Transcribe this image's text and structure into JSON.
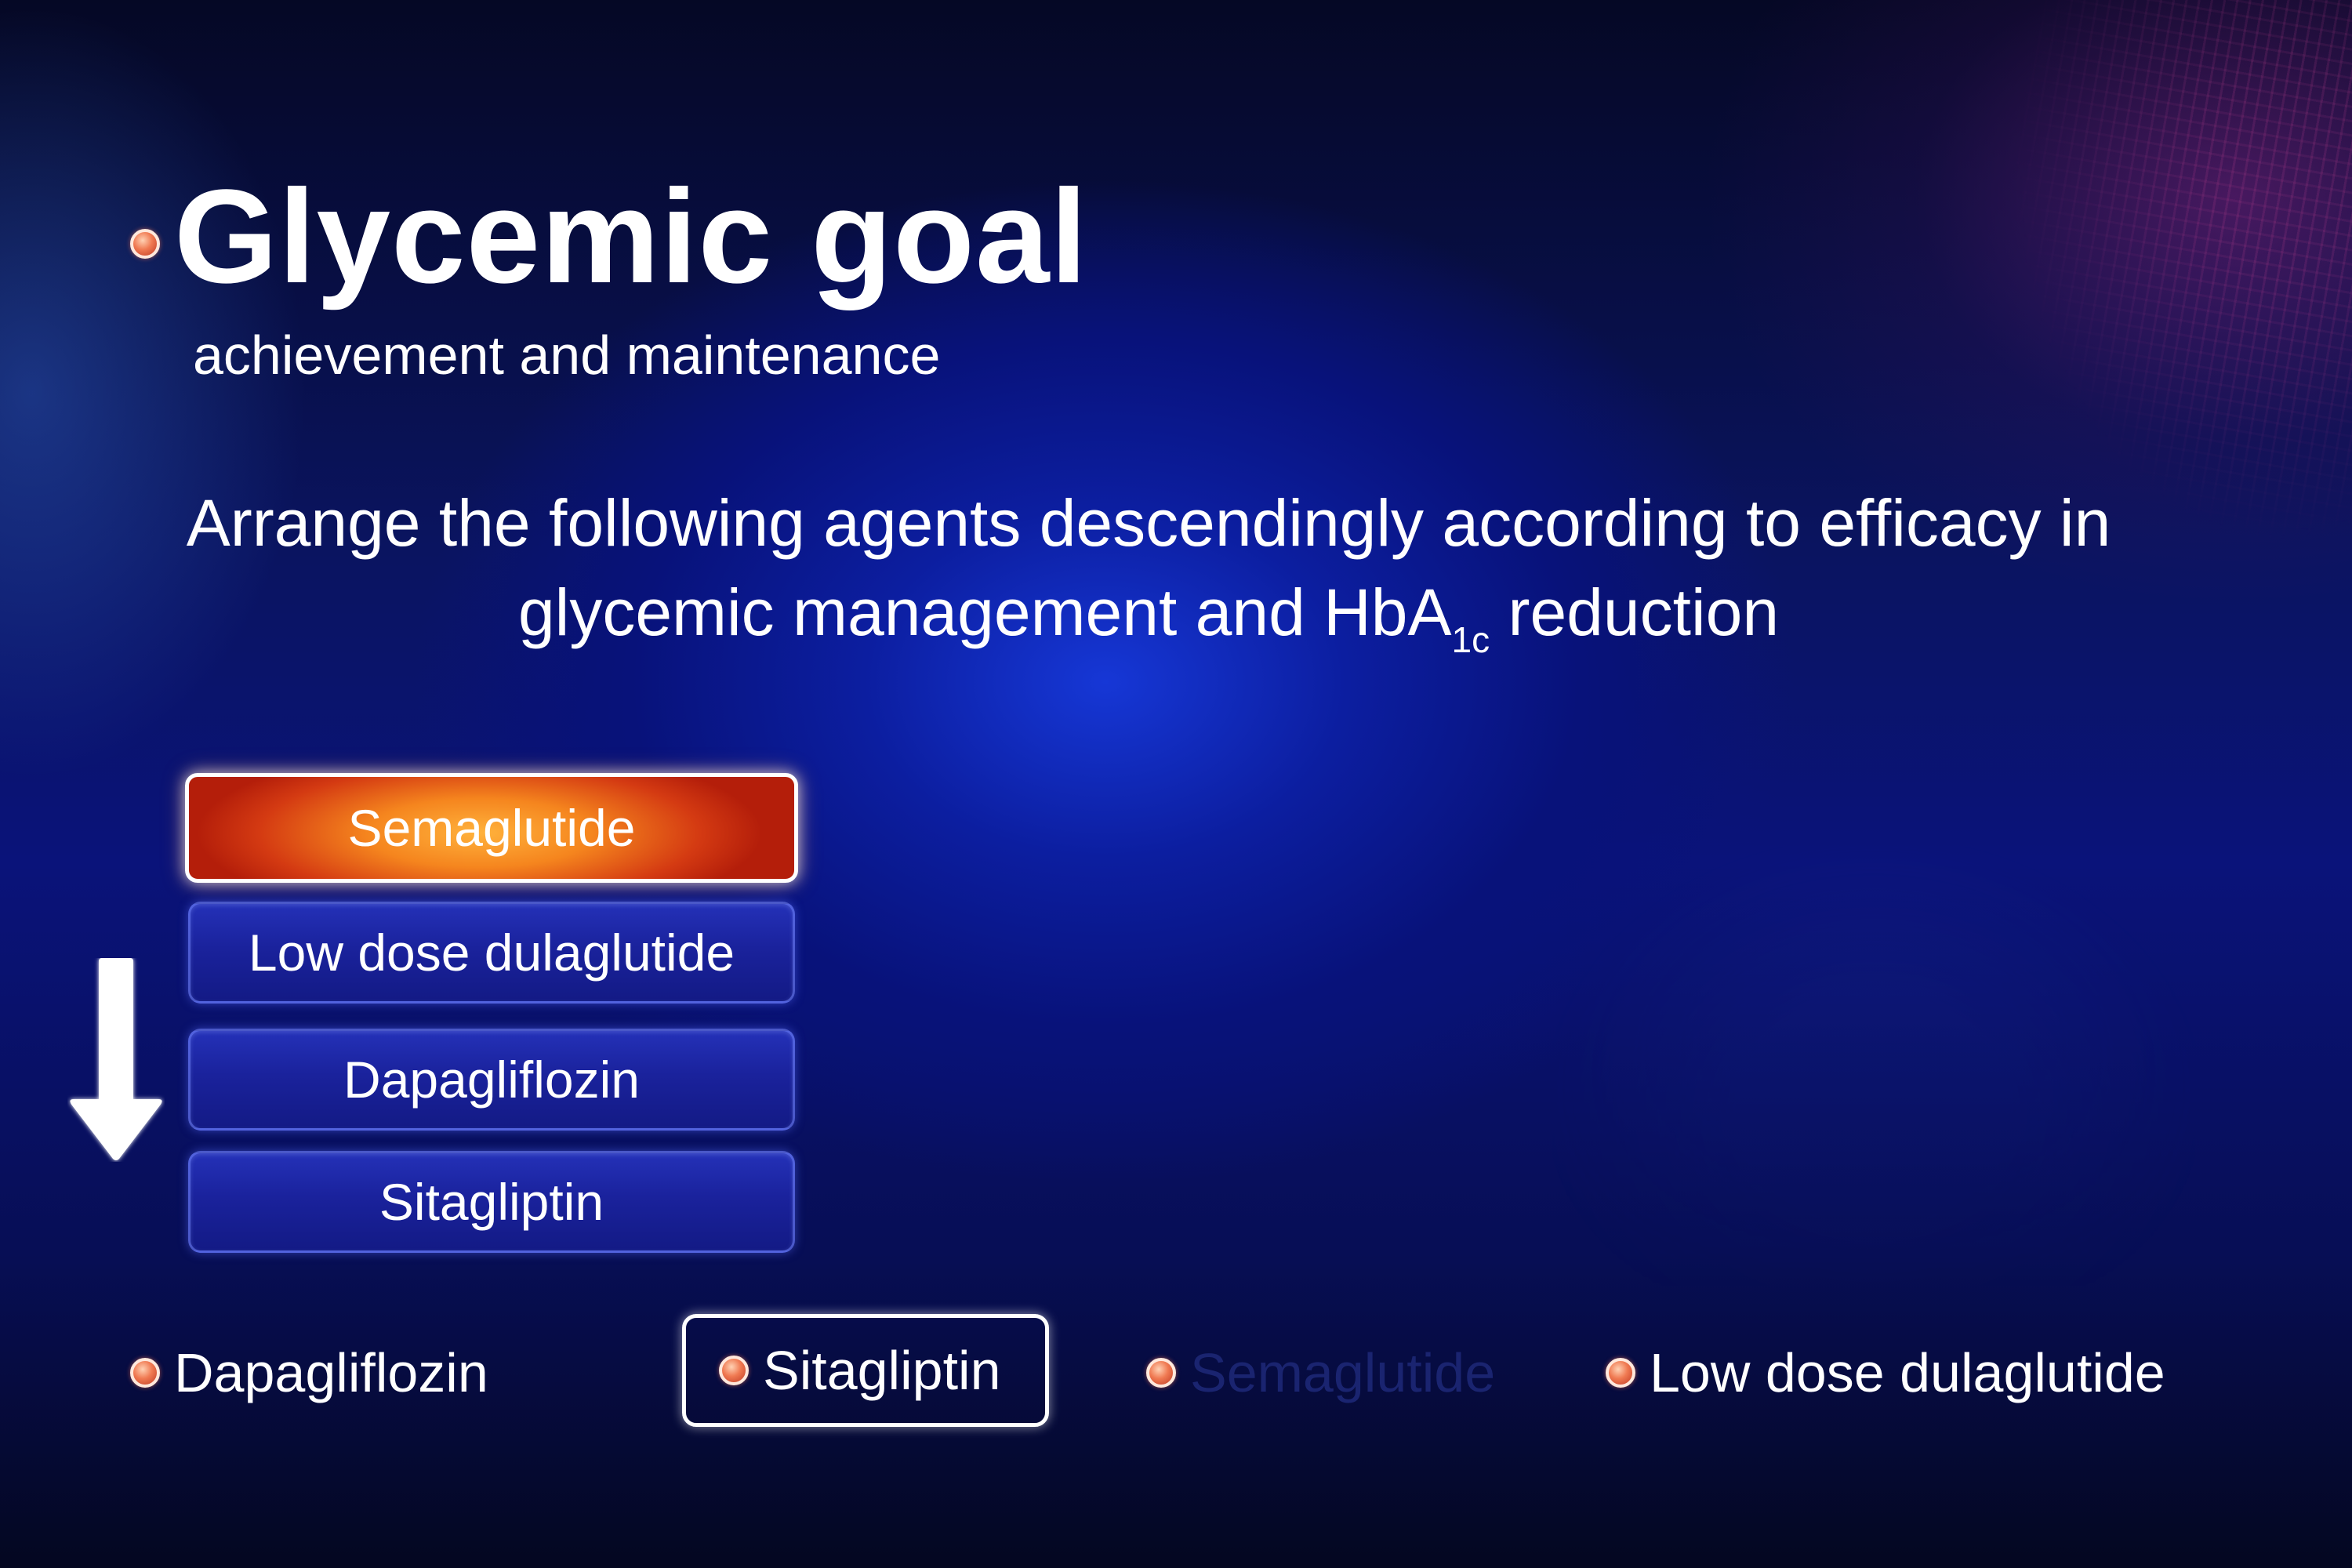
{
  "slide": {
    "title": "Glycemic goal",
    "subtitle": "achievement and maintenance",
    "question_main": "Arrange the following agents descendingly according to efficacy in glycemic management and HbA",
    "question_sub": "1c",
    "question_end": " reduction"
  },
  "ranking": {
    "items": [
      {
        "label": "Semaglutide"
      },
      {
        "label": "Low dose dulaglutide"
      },
      {
        "label": "Dapagliflozin"
      },
      {
        "label": "Sitagliptin"
      }
    ],
    "arrow_icon": "down-arrow-icon"
  },
  "options": [
    {
      "label": "Dapagliflozin",
      "state": "normal"
    },
    {
      "label": "Sitagliptin",
      "state": "selected"
    },
    {
      "label": "Semaglutide",
      "state": "dimmed"
    },
    {
      "label": "Low dose dulaglutide",
      "state": "normal"
    }
  ],
  "colors": {
    "background": "#0a137a",
    "highlight": "#f5851e",
    "box": "#1a229c",
    "bullet": "#f07a52"
  }
}
